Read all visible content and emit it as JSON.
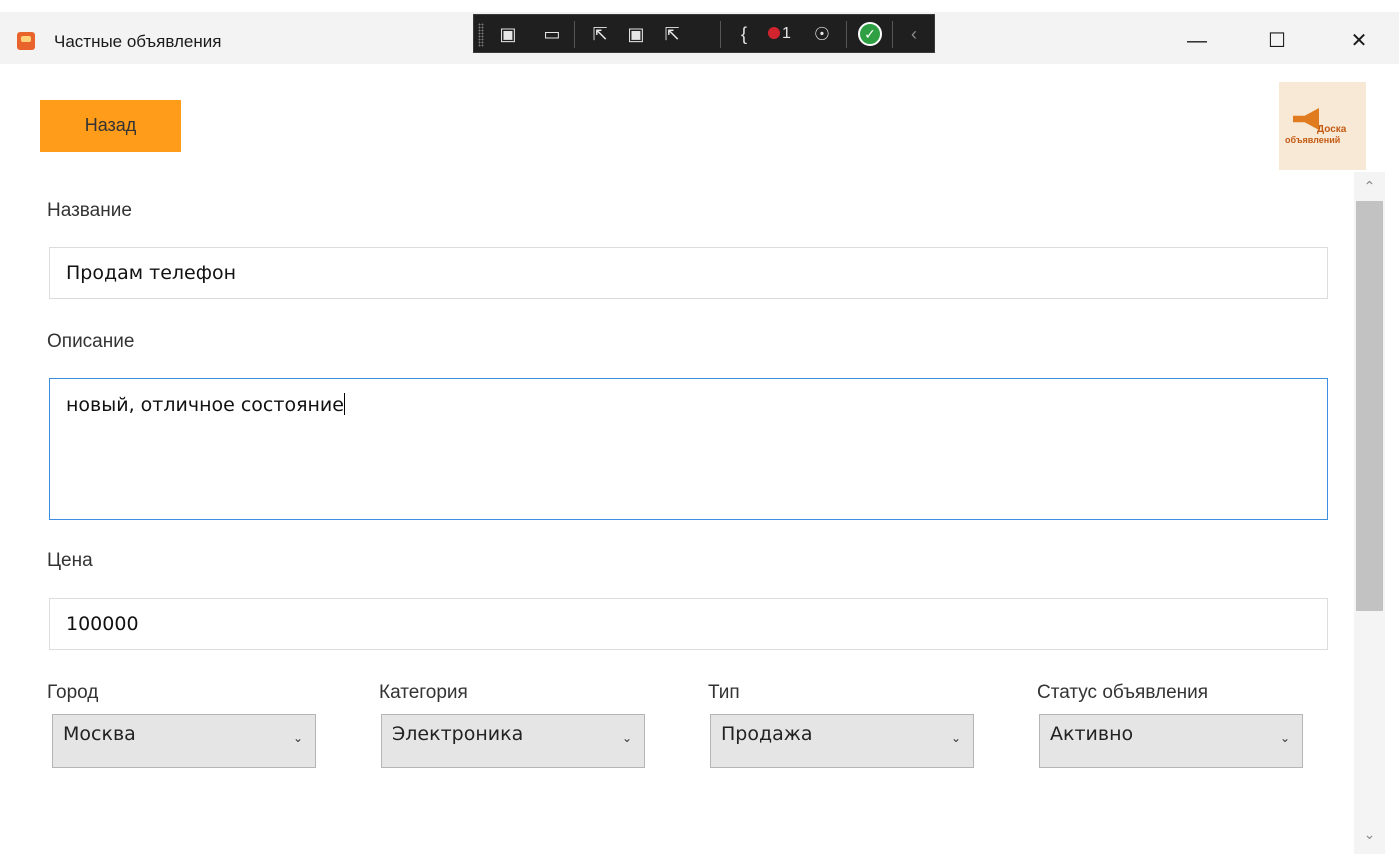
{
  "window": {
    "title": "Частные объявления",
    "minimize_glyph": "—",
    "maximize_glyph": "☐",
    "close_glyph": "✕"
  },
  "devtools": {
    "error_count": "1",
    "icons": [
      "live-tree-icon",
      "record-icon",
      "select-element-icon",
      "display-layout-adorners-icon",
      "track-focus-icon",
      "binding-errors-icon",
      "accessibility-icon",
      "ok-status-icon",
      "collapse-icon"
    ]
  },
  "toolbar": {
    "back_label": "Назад"
  },
  "logo": {
    "line1": "Доска",
    "line2": "объявлений"
  },
  "form": {
    "title_label": "Название",
    "title_value": "Продам телефон",
    "description_label": "Описание",
    "description_value": "новый, отличное состояние",
    "price_label": "Цена",
    "price_value": "100000",
    "city_label": "Город",
    "city_value": "Москва",
    "category_label": "Категория",
    "category_value": "Электроника",
    "type_label": "Тип",
    "type_value": "Продажа",
    "status_label": "Статус объявления",
    "status_value": "Активно"
  },
  "colors": {
    "accent": "#ff9c1a",
    "focus_border": "#3d8de0",
    "logo_bg": "#f7e9d6"
  }
}
